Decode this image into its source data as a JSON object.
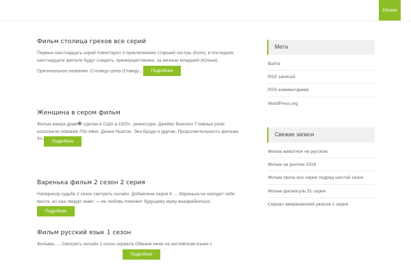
{
  "nav": {
    "home_label": "Home"
  },
  "posts": [
    {
      "title": "Фильм столица грехов все серий",
      "excerpt_lines": [
        "Первые шестнадцать серий повествуют о приключениях старшей сестры (Кати), в последних",
        "шестнадцати зрители будут следить, преимущественно, за жизнью младшей (Юльки)."
      ],
      "excerpt_tail": "Оригинальное название: Столица греха (Гламур...",
      "more_label": "Подробнее"
    },
    {
      "title": "Женщина в сером фильм",
      "excerpt_lines": [
        "Фильм жанра драм� сделан в США в 1920г., режиссура: Джеймс Винсент. Главные роли",
        "исполнили Adelaide Fitz-Allen, Денни Ньютон, Энн Броди и другие. Продолжительность фильма",
        "3ч..."
      ],
      "more_label": "Подробнее"
    },
    {
      "title": "Варенька фильм 2 сезон 2 серия",
      "excerpt_lines": [
        "Наперекор судьбе 2 сезон смотреть онлайн. Добавлена серия 4. ... Варенька не находит себе",
        "места, но она твердо знает — ее любовь поможет будущему мужу выкарабкаться."
      ],
      "more_label": "Подробнее"
    },
    {
      "title": "Фильм русский язык 1 сезон",
      "excerpt_lines": [
        "Фильмы. ... Смотреть онлайн 1 сезон сериала Обмани меня на английском языке с"
      ],
      "more_label": "Подробнее"
    }
  ],
  "sidebar": {
    "meta": {
      "title": "Мета",
      "items": [
        "Войти",
        "RSS записей",
        "RSS комментариев",
        "WordPress.org"
      ]
    },
    "recent": {
      "title": "Свежие записи",
      "items": [
        "Фильм животное на русском",
        "Фильм на разлом 2016",
        "Фильм сваты все серии подряд шестой сезон",
        "Фильм фатмагуль 31 серия",
        "Сериал американский ужасов 1 серия"
      ]
    }
  },
  "colors": {
    "accent": "#8cbf26",
    "widget_bg": "#f1f1f1"
  }
}
